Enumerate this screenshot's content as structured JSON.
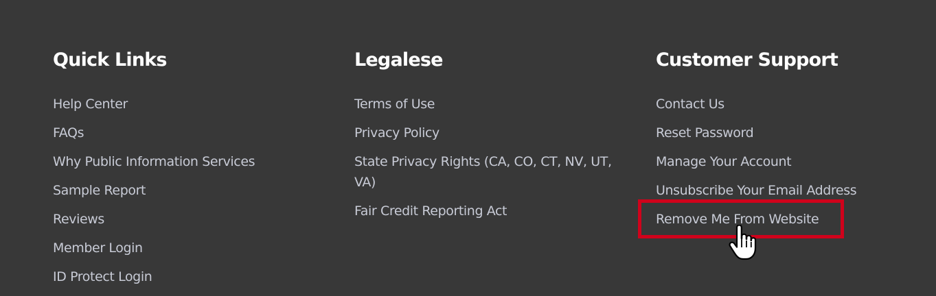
{
  "footer": {
    "columns": [
      {
        "heading": "Quick Links",
        "links": [
          "Help Center",
          "FAQs",
          "Why Public Information Services",
          "Sample Report",
          "Reviews",
          "Member Login",
          "ID Protect Login"
        ]
      },
      {
        "heading": "Legalese",
        "links": [
          "Terms of Use",
          "Privacy Policy",
          "State Privacy Rights (CA, CO, CT, NV, UT, VA)",
          "Fair Credit Reporting Act"
        ]
      },
      {
        "heading": "Customer Support",
        "links": [
          "Contact Us",
          "Reset Password",
          "Manage Your Account",
          "Unsubscribe Your Email Address",
          "Remove Me From Website"
        ]
      }
    ]
  },
  "colors": {
    "background": "#383838",
    "heading": "#ffffff",
    "link": "#c8cbd6",
    "highlight": "#d0021b"
  },
  "icons": {
    "cursor": "hand-pointer-icon"
  }
}
